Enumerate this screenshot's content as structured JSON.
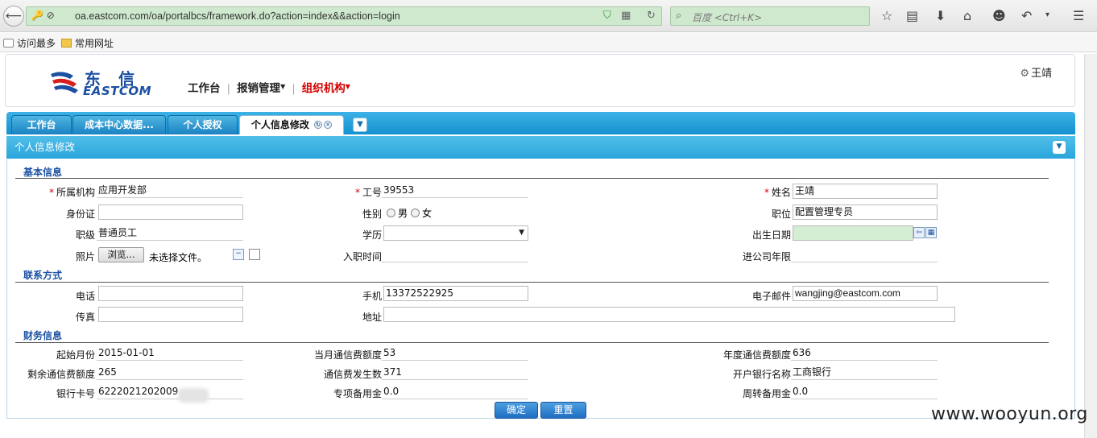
{
  "browser": {
    "url": "oa.eastcom.com/oa/portalbcs/framework.do?action=index&&action=login",
    "search_placeholder": "百度 <Ctrl+K>",
    "bookmarks": [
      "访问最多",
      "常用网址"
    ]
  },
  "header": {
    "logo_cn": "东信",
    "logo_en": "EASTCOM",
    "menu": [
      "工作台",
      "报销管理",
      "组织机构"
    ],
    "user": "王靖"
  },
  "tabs": [
    "工作台",
    "成本中心数据...",
    "个人授权",
    "个人信息修改"
  ],
  "panel": {
    "title": "个人信息修改",
    "sections": {
      "basic": "基本信息",
      "contact": "联系方式",
      "finance": "财务信息"
    },
    "basic": {
      "org_label": "所属机构",
      "org_value": "应用开发部",
      "empno_label": "工号",
      "empno_value": "39553",
      "name_label": "姓名",
      "name_value": "王靖",
      "id_label": "身份证",
      "id_value": "",
      "gender_label": "性别",
      "gender_male": "男",
      "gender_female": "女",
      "position_label": "职位",
      "position_value": "配置管理专员",
      "level_label": "职级",
      "level_value": "普通员工",
      "edu_label": "学历",
      "edu_value": "",
      "birth_label": "出生日期",
      "birth_value": "",
      "photo_label": "照片",
      "browse_label": "浏览...",
      "file_status": "未选择文件。",
      "join_label": "入职时间",
      "join_value": "",
      "years_label": "进公司年限",
      "years_value": ""
    },
    "contact": {
      "phone_label": "电话",
      "phone_value": "",
      "mobile_label": "手机",
      "mobile_value": "13372522925",
      "email_label": "电子邮件",
      "email_value": "wangjing@eastcom.com",
      "fax_label": "传真",
      "fax_value": "",
      "address_label": "地址",
      "address_value": ""
    },
    "finance": {
      "start_month_label": "起始月份",
      "start_month_value": "2015-01-01",
      "monthly_quota_label": "当月通信费额度",
      "monthly_quota_value": "53",
      "annual_quota_label": "年度通信费额度",
      "annual_quota_value": "636",
      "remaining_label": "剩余通信费额度",
      "remaining_value": "265",
      "incurred_label": "通信费发生数",
      "incurred_value": "371",
      "bank_name_label": "开户银行名称",
      "bank_name_value": "工商银行",
      "card_label": "银行卡号",
      "card_value": "6222021202009",
      "special_label": "专项备用金",
      "special_value": "0.0",
      "revolving_label": "周转备用金",
      "revolving_value": "0.0"
    },
    "buttons": {
      "confirm": "确定",
      "reset": "重置"
    }
  },
  "watermark": "www.wooyun.org"
}
